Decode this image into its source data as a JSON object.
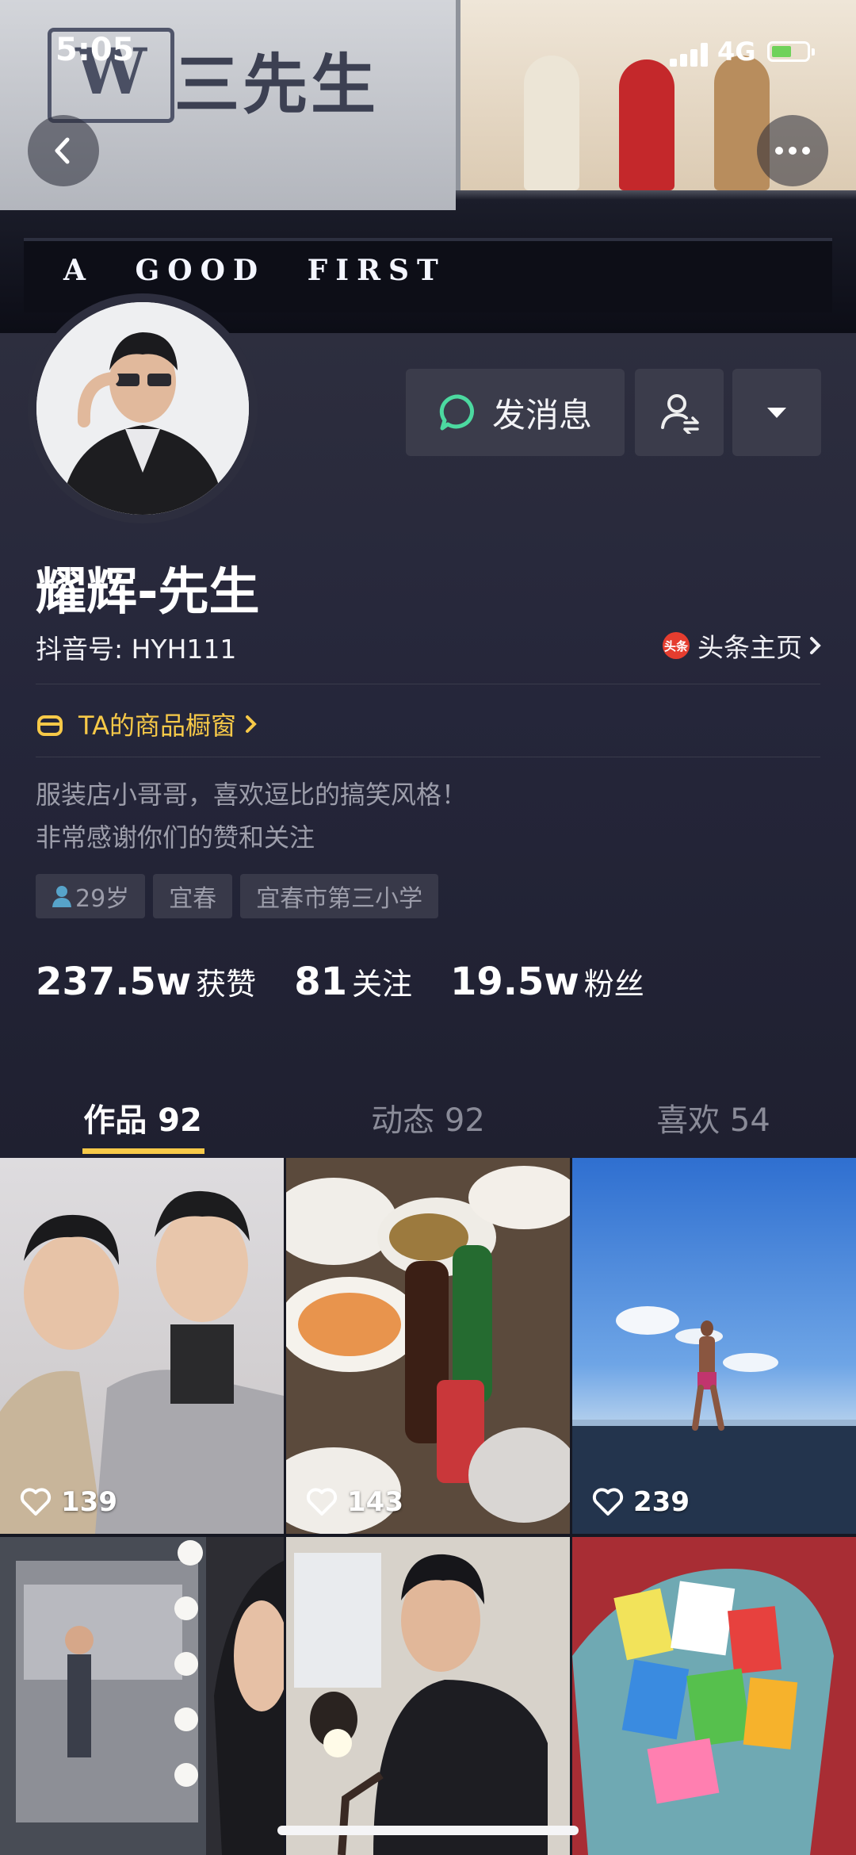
{
  "status_bar": {
    "time": "5:05",
    "network": "4G"
  },
  "cover": {
    "brand_text": "三先生",
    "logo_text": "W",
    "slogan": "A GOOD FIRST"
  },
  "header": {
    "message_button_label": "发消息"
  },
  "profile": {
    "nickname": "耀辉-先生",
    "douyin_id": "抖音号: HYH111",
    "toutiao_badge": "头条",
    "toutiao_label": "头条主页",
    "shop_label": "TA的商品橱窗",
    "bio_line1": "服装店小哥哥，喜欢逗比的搞笑风格！",
    "bio_line2": "非常感谢你们的赞和关注",
    "tags": [
      "29岁",
      "宜春",
      "宜春市第三小学"
    ]
  },
  "stats": [
    {
      "value": "237.5w",
      "label": "获赞"
    },
    {
      "value": "81",
      "label": "关注"
    },
    {
      "value": "19.5w",
      "label": "粉丝"
    }
  ],
  "tabs": [
    {
      "label": "作品 92",
      "active": true
    },
    {
      "label": "动态 92",
      "active": false
    },
    {
      "label": "喜欢 54",
      "active": false
    }
  ],
  "videos": [
    {
      "likes": "139"
    },
    {
      "likes": "143"
    },
    {
      "likes": "239"
    },
    {
      "likes": ""
    },
    {
      "likes": ""
    },
    {
      "likes": ""
    }
  ],
  "colors": {
    "accent": "#f7c948",
    "background": "#161823",
    "panel": "#2d2e3e",
    "toutiao_red": "#e53d2f"
  }
}
